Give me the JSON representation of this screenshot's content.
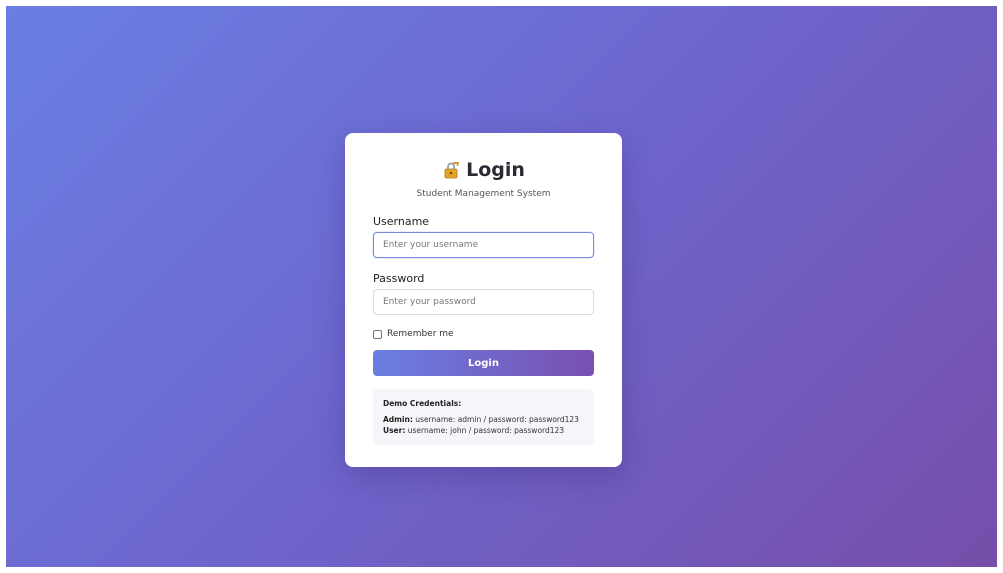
{
  "header": {
    "title": "Login",
    "subtitle": "Student Management System",
    "icon": "lock-with-key-icon"
  },
  "form": {
    "username_label": "Username",
    "username_placeholder": "Enter your username",
    "username_value": "",
    "password_label": "Password",
    "password_placeholder": "Enter your password",
    "password_value": "",
    "remember_label": "Remember me",
    "remember_checked": false,
    "submit_label": "Login"
  },
  "demo": {
    "title": "Demo Credentials:",
    "admin_role": "Admin:",
    "admin_text": "username: admin / password: password123",
    "user_role": "User:",
    "user_text": "username: john / password: password123"
  },
  "colors": {
    "gradient_start": "#6a7fe3",
    "gradient_end": "#764ea9",
    "card_background": "#ffffff"
  }
}
